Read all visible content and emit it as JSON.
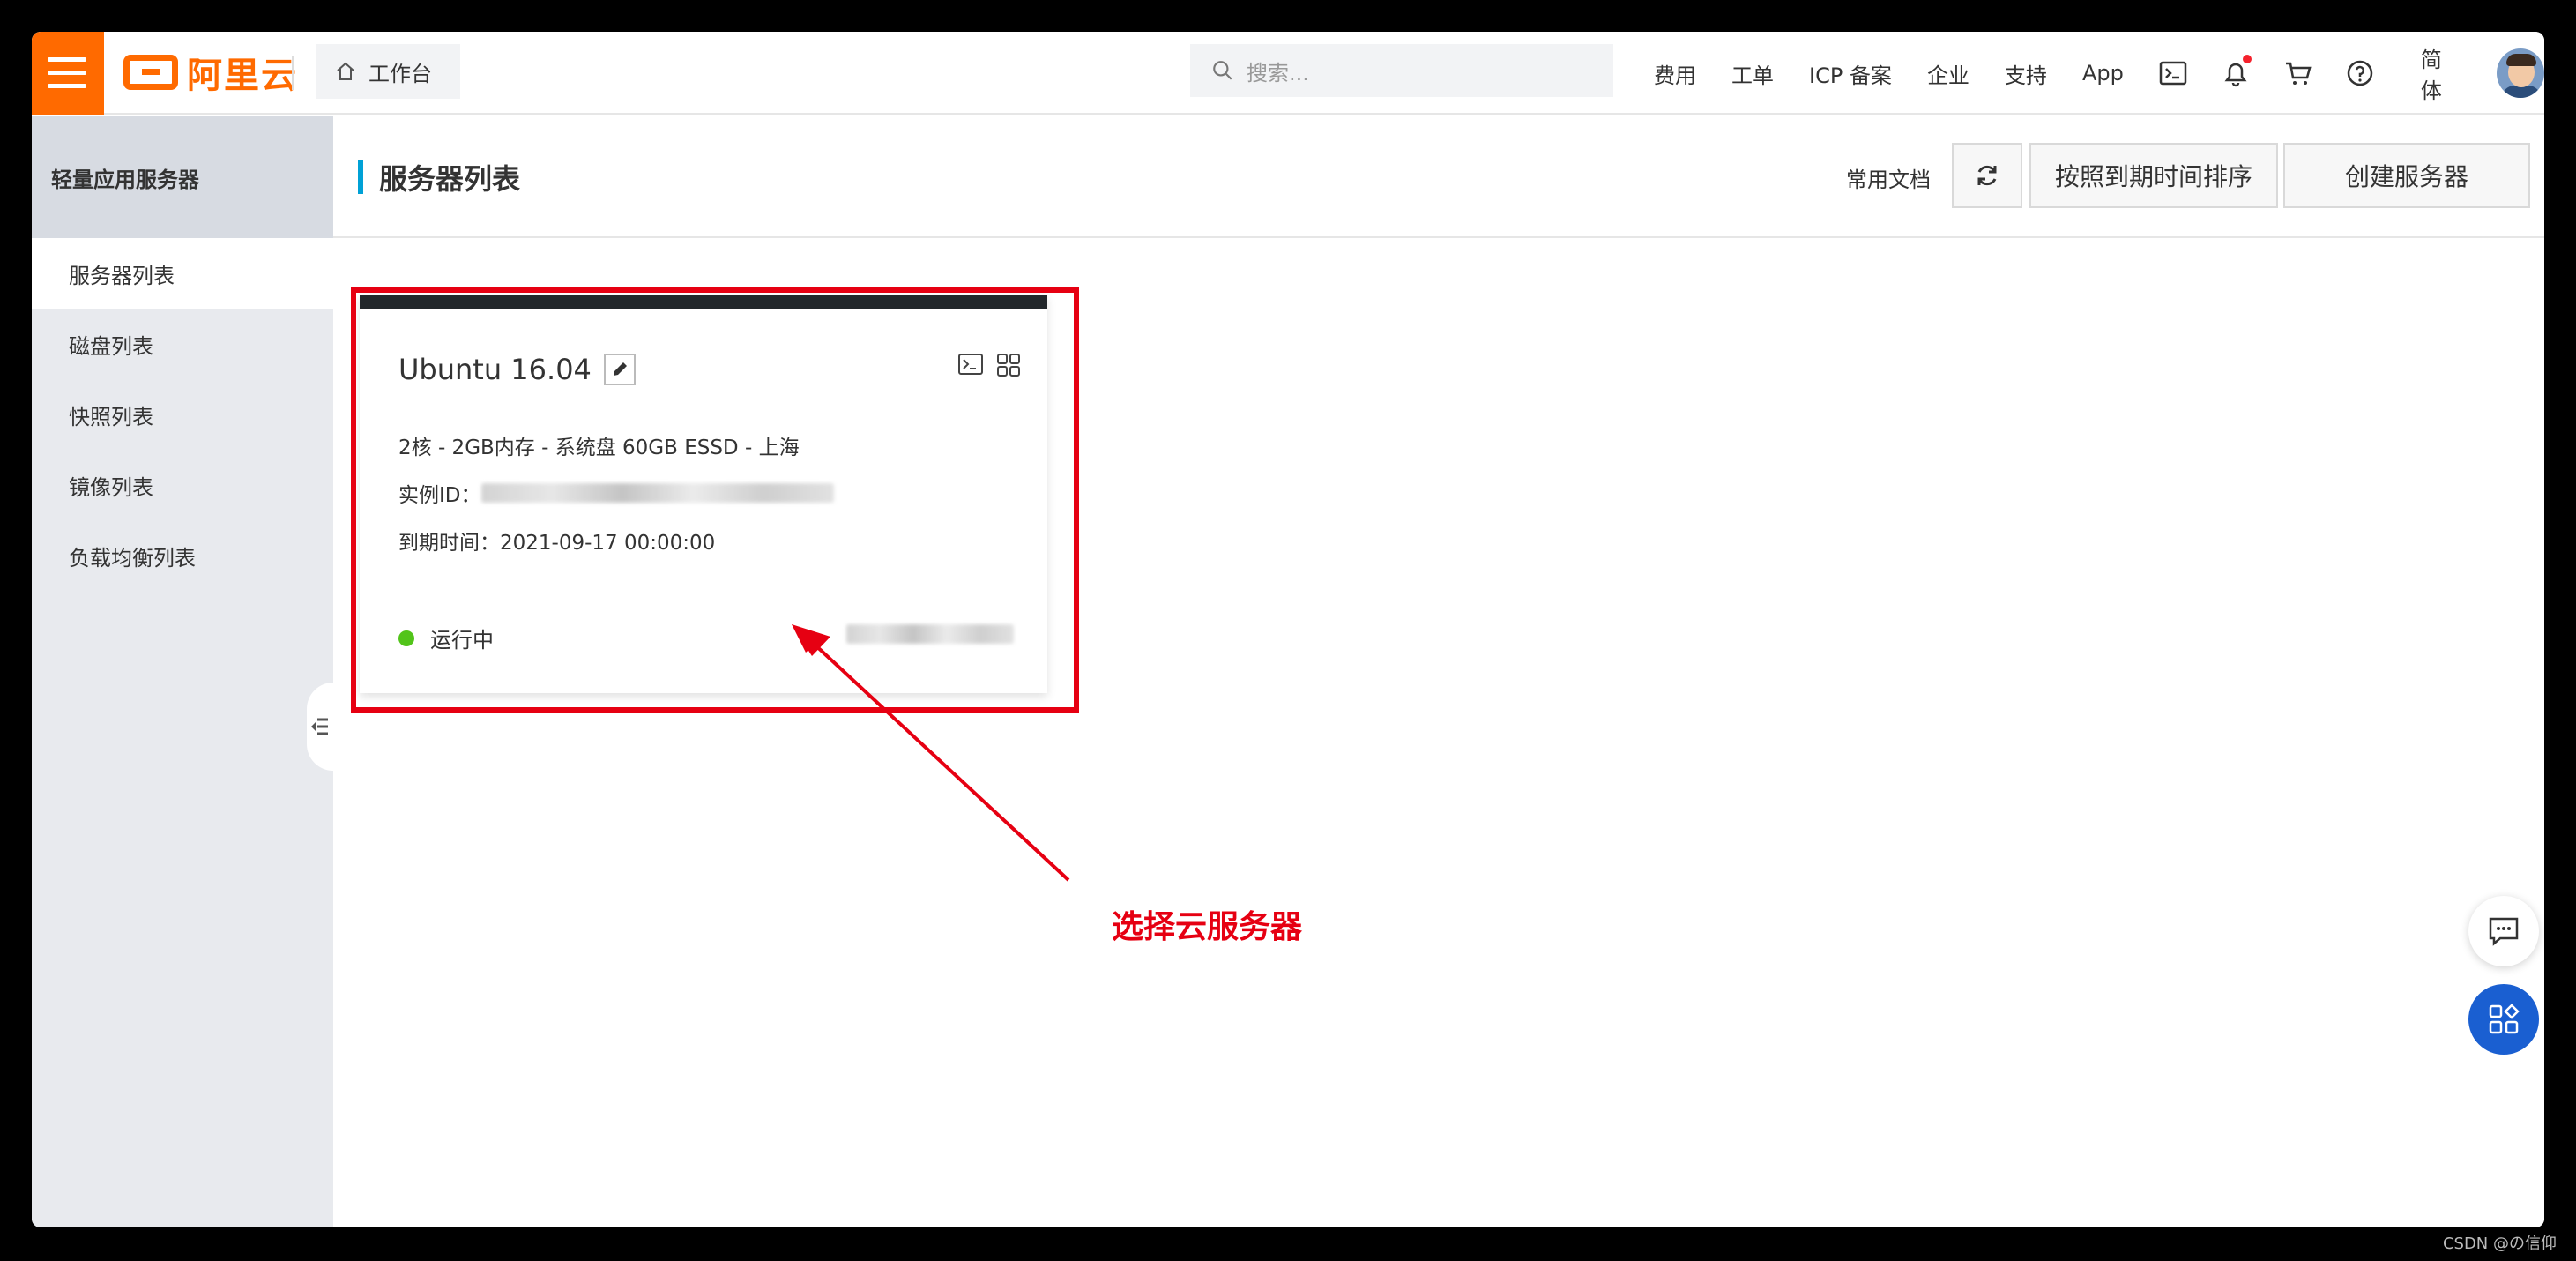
{
  "topbar": {
    "logo_text": "阿里云",
    "workbench_label": "工作台",
    "search_placeholder": "搜索...",
    "nav_links": [
      "费用",
      "工单",
      "ICP 备案",
      "企业",
      "支持",
      "App"
    ],
    "language_label": "简体",
    "brand_color": "#ff6a00"
  },
  "sidebar": {
    "title": "轻量应用服务器",
    "items": [
      {
        "label": "服务器列表",
        "active": true
      },
      {
        "label": "磁盘列表",
        "active": false
      },
      {
        "label": "快照列表",
        "active": false
      },
      {
        "label": "镜像列表",
        "active": false
      },
      {
        "label": "负载均衡列表",
        "active": false
      }
    ]
  },
  "header": {
    "title": "服务器列表",
    "docs_label": "常用文档",
    "sort_label": "按照到期时间排序",
    "create_label": "创建服务器"
  },
  "server_card": {
    "name": "Ubuntu 16.04",
    "specs": "2核 - 2GB内存 - 系统盘 60GB ESSD - 上海",
    "instance_label": "实例ID：",
    "expire_text": "到期时间：2021-09-17 00:00:00",
    "status_label": "运行中",
    "status_color": "#52c41a"
  },
  "annotation": {
    "text": "选择云服务器",
    "color": "#e60012"
  },
  "watermark": "CSDN @の信仰"
}
